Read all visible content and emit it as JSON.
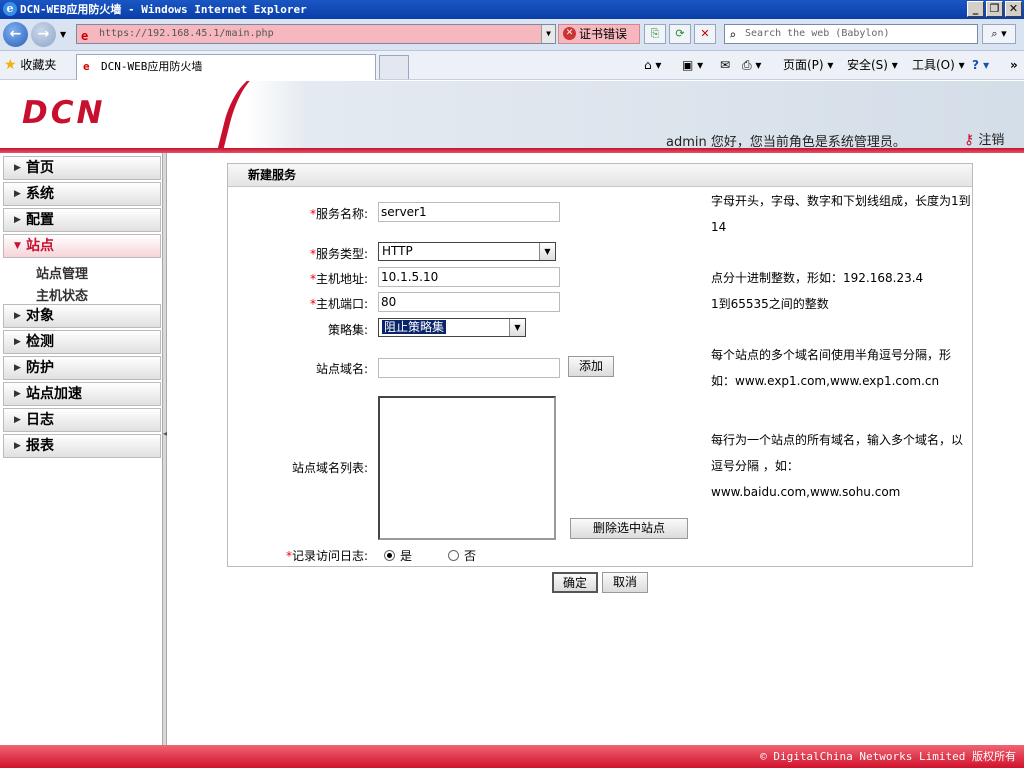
{
  "window": {
    "title": "DCN-WEB应用防火墙 - Windows Internet Explorer"
  },
  "browser": {
    "url": "https://192.168.45.1/main.php",
    "cert_error": "证书错误",
    "search_placeholder": "Search the web (Babylon)",
    "favorites": "收藏夹",
    "tab_title": "DCN-WEB应用防火墙",
    "cmd": {
      "page": "页面(P)",
      "safety": "安全(S)",
      "tools": "工具(O)"
    }
  },
  "header": {
    "logo": "DCN",
    "welcome": "admin 您好，您当前角色是系统管理员。",
    "logout": "注销"
  },
  "sidebar": {
    "items": [
      {
        "label": "首页"
      },
      {
        "label": "系统"
      },
      {
        "label": "配置"
      },
      {
        "label": "站点"
      },
      {
        "label": "对象"
      },
      {
        "label": "检测"
      },
      {
        "label": "防护"
      },
      {
        "label": "站点加速"
      },
      {
        "label": "日志"
      },
      {
        "label": "报表"
      }
    ],
    "sub": [
      "站点管理",
      "主机状态"
    ]
  },
  "form": {
    "title": "新建服务",
    "service_name": {
      "label": "服务名称:",
      "value": "server1",
      "hint": "字母开头，字母、数字和下划线组成，长度为1到14"
    },
    "service_type": {
      "label": "服务类型:",
      "value": "HTTP"
    },
    "host_addr": {
      "label": "主机地址:",
      "value": "10.1.5.10",
      "hint": "点分十进制整数，形如：192.168.23.4"
    },
    "host_port": {
      "label": "主机端口:",
      "value": "80",
      "hint": "1到65535之间的整数"
    },
    "policy": {
      "label": "策略集:",
      "value": "阻止策略集"
    },
    "domain": {
      "label": "站点域名:",
      "value": "",
      "add_button": "添加",
      "hint": "每个站点的多个域名间使用半角逗号分隔，形如：www.exp1.com,www.exp1.com.cn"
    },
    "domain_list": {
      "label": "站点域名列表:",
      "delete_button": "删除选中站点",
      "hint1": "每行为一个站点的所有域名，输入多个域名，以逗号分隔 ，如：",
      "hint2": "www.baidu.com,www.sohu.com"
    },
    "log": {
      "label": "记录访问日志:",
      "yes": "是",
      "no": "否",
      "selected": "是"
    },
    "ok": "确定",
    "cancel": "取消"
  },
  "footer": {
    "copyright": "© DigitalChina Networks Limited 版权所有"
  }
}
